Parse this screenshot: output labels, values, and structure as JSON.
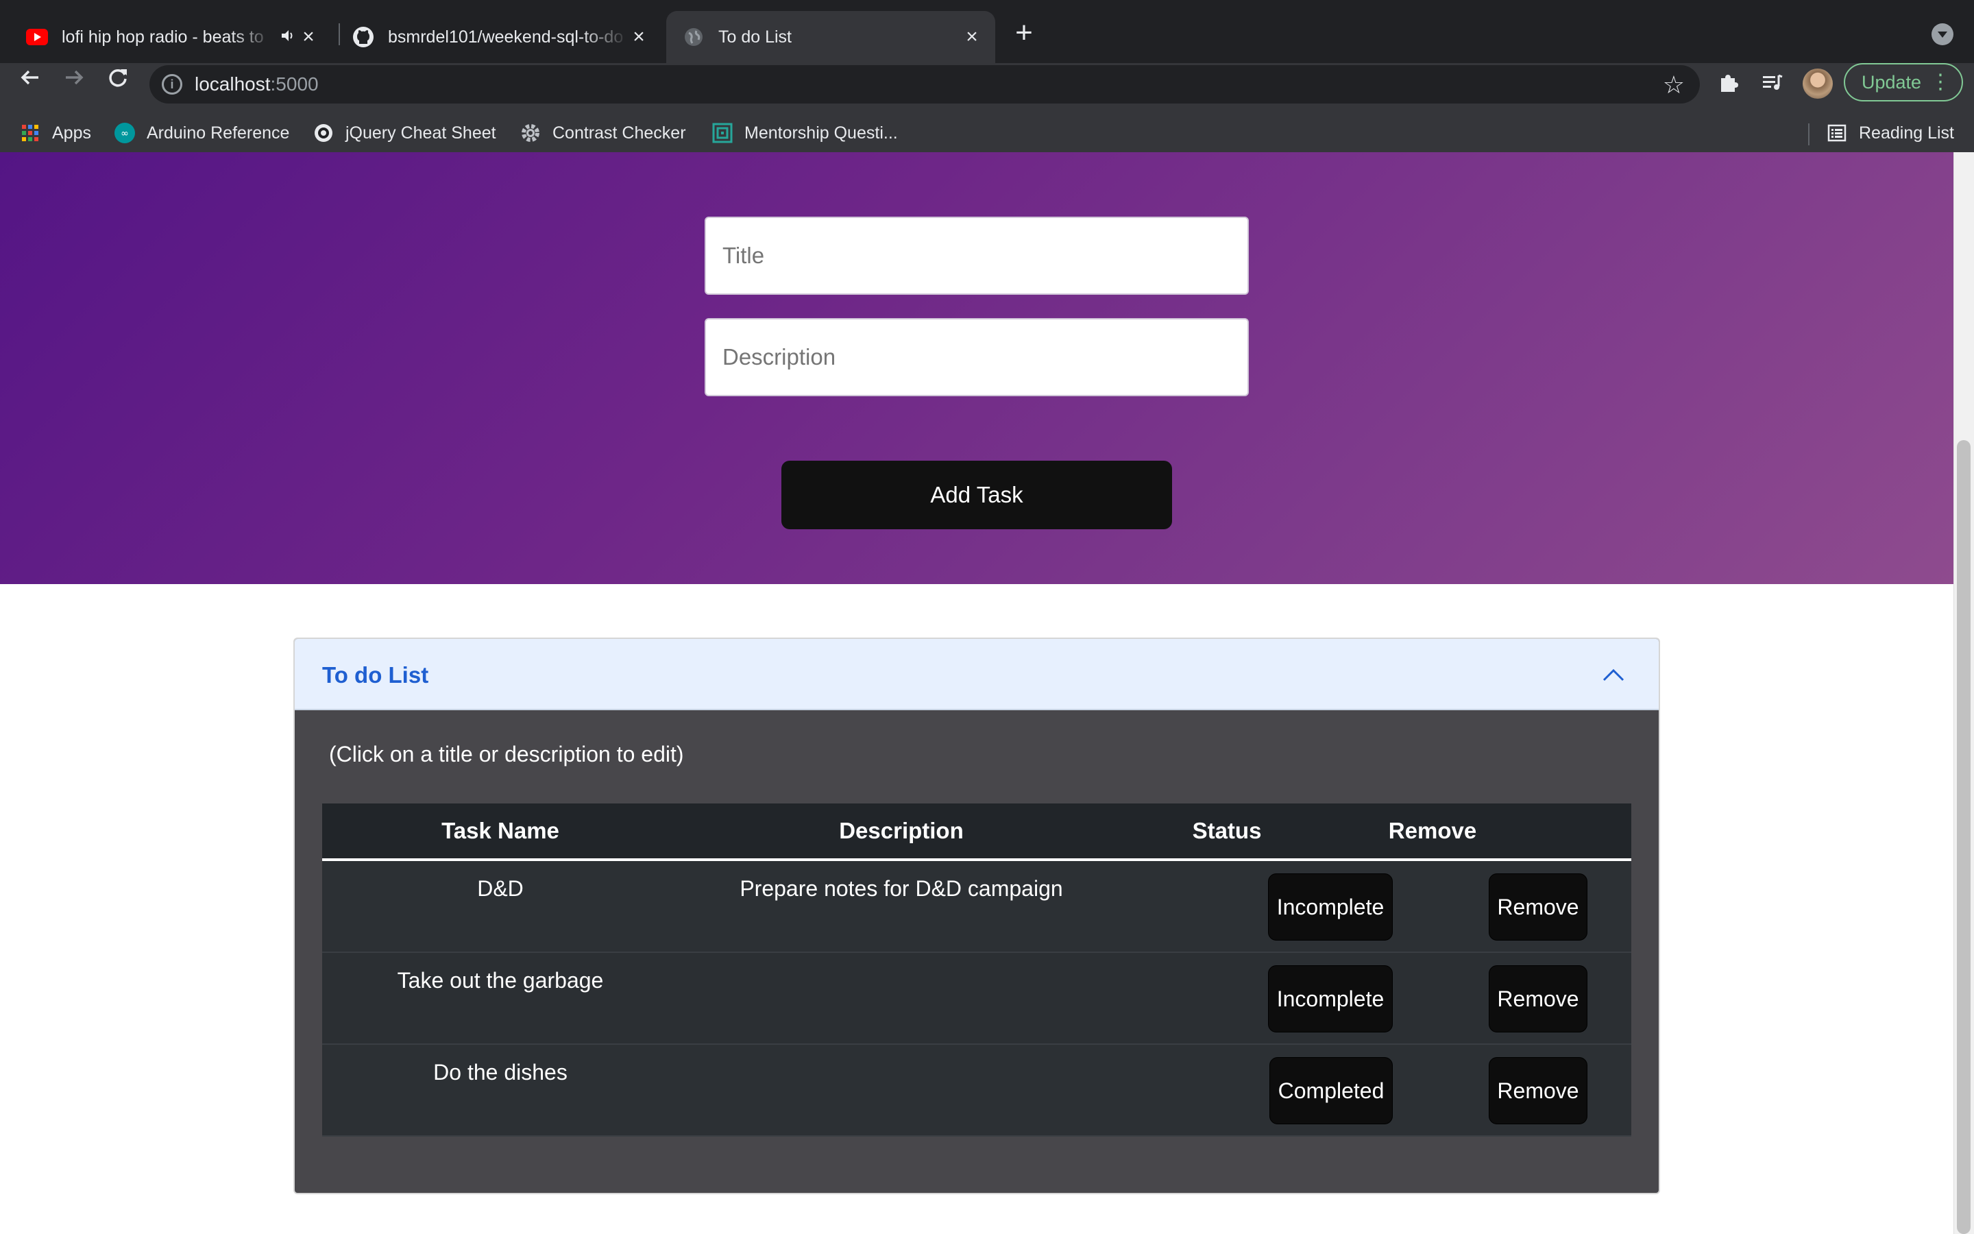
{
  "browser": {
    "tabs": [
      {
        "title": "lofi hip hop radio - beats to",
        "icon": "youtube-icon",
        "audio": true
      },
      {
        "title": "bsmrdel101/weekend-sql-to-do",
        "icon": "github-icon"
      },
      {
        "title": "To do List",
        "icon": "globe-icon",
        "active": true
      }
    ],
    "address": {
      "host": "localhost",
      "port": ":5000"
    },
    "update_label": "Update",
    "bookmarks": [
      {
        "label": "Apps",
        "icon": "apps-grid-icon"
      },
      {
        "label": "Arduino Reference",
        "icon": "arduino-icon"
      },
      {
        "label": "jQuery Cheat Sheet",
        "icon": "jquery-icon"
      },
      {
        "label": "Contrast Checker",
        "icon": "gear-icon"
      },
      {
        "label": "Mentorship Questi...",
        "icon": "mentorship-icon"
      }
    ],
    "reading_list_label": "Reading List"
  },
  "form": {
    "title_placeholder": "Title",
    "description_placeholder": "Description",
    "add_button": "Add Task"
  },
  "todo": {
    "heading": "To do List",
    "hint": "(Click on a title or description to edit)",
    "columns": [
      "Task Name",
      "Description",
      "Status",
      "Remove"
    ],
    "rows": [
      {
        "name": "D&D",
        "description": "Prepare notes for D&D campaign",
        "status": "Incomplete",
        "remove": "Remove"
      },
      {
        "name": "Take out the garbage",
        "description": "",
        "status": "Incomplete",
        "remove": "Remove"
      },
      {
        "name": "Do the dishes",
        "description": "",
        "status": "Completed",
        "remove": "Remove"
      }
    ]
  },
  "colors": {
    "hero_gradient_start": "#541585",
    "hero_gradient_end": "#8e4b8e",
    "accordion_title": "#1f5fd1",
    "table_bg": "#2c3034"
  }
}
